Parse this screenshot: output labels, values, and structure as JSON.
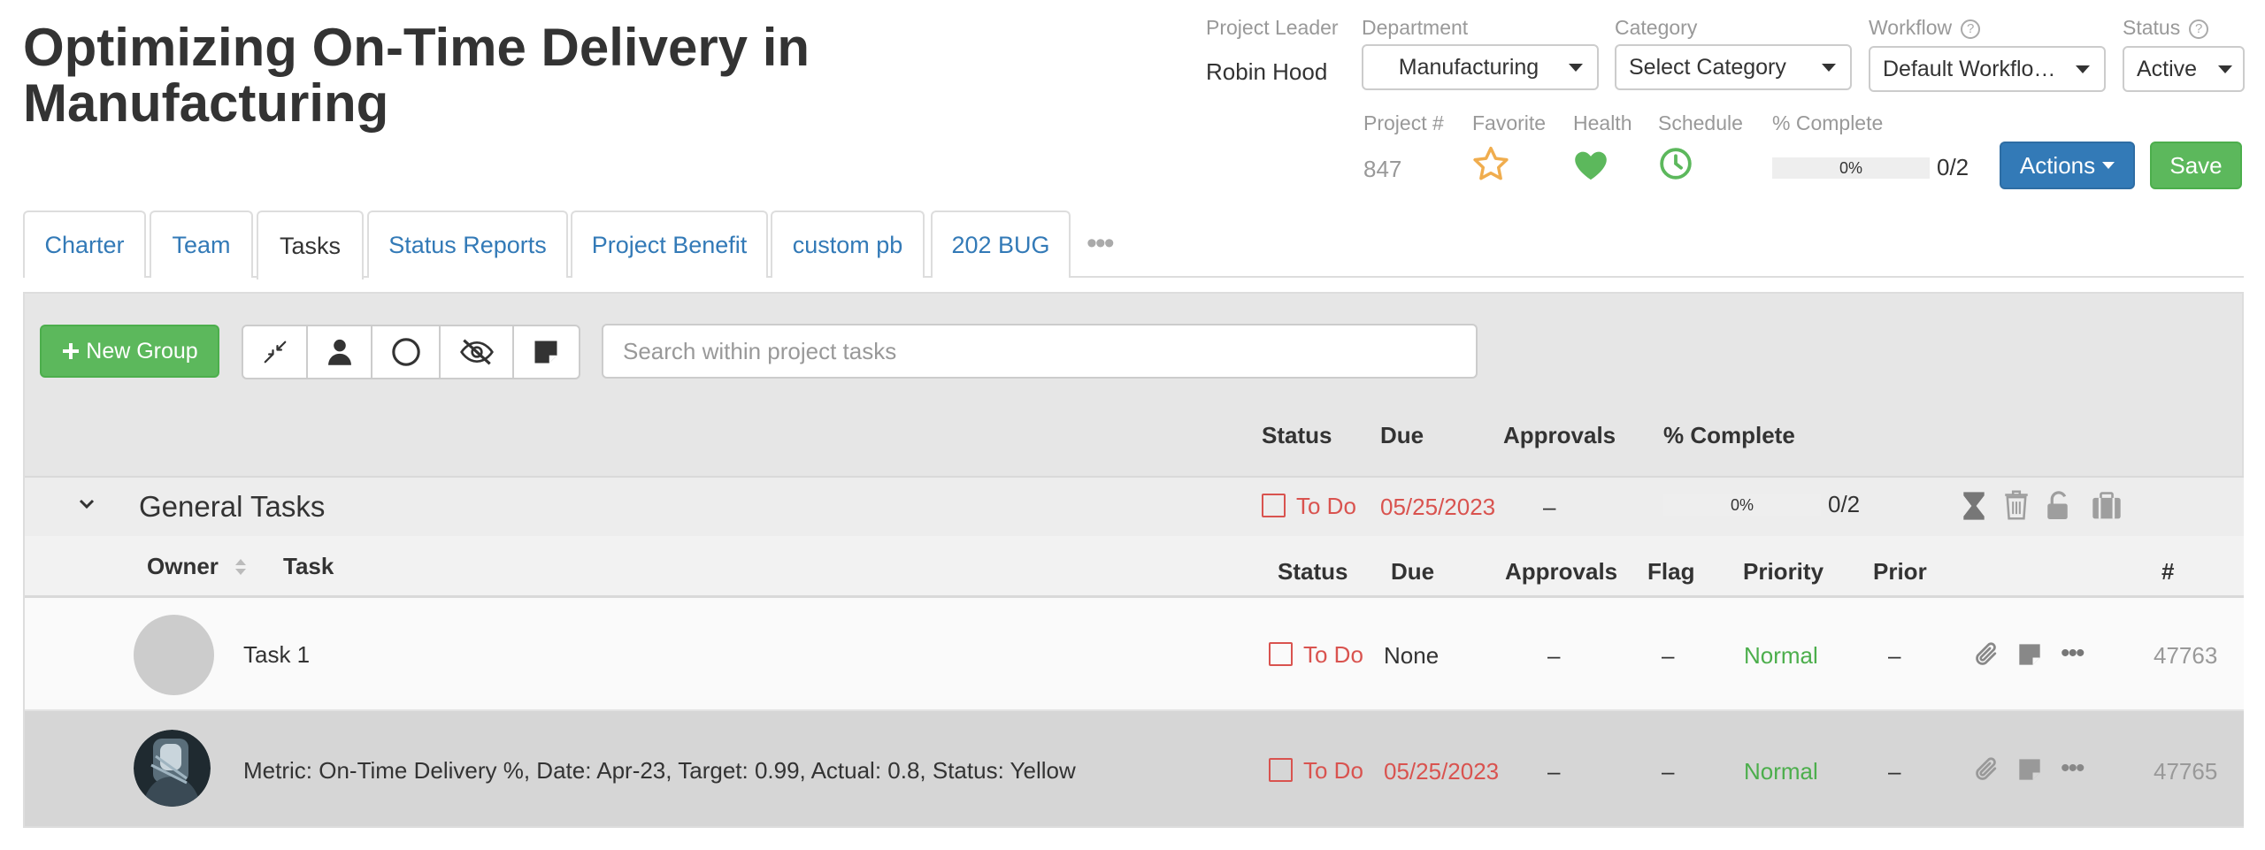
{
  "project": {
    "title": "Optimizing On-Time Delivery in Manufacturing",
    "leader_label": "Project Leader",
    "leader": "Robin Hood",
    "department_label": "Department",
    "department": "Manufacturing",
    "category_label": "Category",
    "category": "Select Category",
    "workflow_label": "Workflow",
    "workflow": "Default Workflo…",
    "status_label": "Status",
    "status": "Active",
    "number_label": "Project #",
    "number": "847",
    "favorite_label": "Favorite",
    "health_label": "Health",
    "schedule_label": "Schedule",
    "complete_label": "% Complete",
    "complete_pct": "0%",
    "complete_fraction": 0,
    "complete_count": "0/2",
    "actions_label": "Actions",
    "save_label": "Save"
  },
  "colors": {
    "link": "#337ab7",
    "success": "#5cb85c",
    "danger": "#d9534f",
    "favorite": "#f0ad4e",
    "health": "#5cb85c",
    "schedule": "#5cb85c"
  },
  "tabs": [
    {
      "label": "Charter"
    },
    {
      "label": "Team"
    },
    {
      "label": "Tasks",
      "active": true
    },
    {
      "label": "Status Reports"
    },
    {
      "label": "Project Benefit"
    },
    {
      "label": "custom pb"
    },
    {
      "label": "202 BUG"
    }
  ],
  "toolbar": {
    "new_group_label": "New Group",
    "icons": [
      "collapse-icon",
      "user-icon",
      "circle-icon",
      "eye-slash-icon",
      "note-icon"
    ],
    "search_placeholder": "Search within project tasks"
  },
  "group_header": {
    "status": "Status",
    "due": "Due",
    "approvals": "Approvals",
    "complete": "% Complete"
  },
  "group": {
    "name": "General Tasks",
    "status": "To Do",
    "due": "05/25/2023",
    "approvals": "–",
    "complete_pct": "0%",
    "complete_fraction": 0,
    "complete_count": "0/2",
    "icons": [
      "hourglass-icon",
      "trash-icon",
      "unlock-icon",
      "clipboard-icon"
    ]
  },
  "task_columns": {
    "owner": "Owner",
    "task": "Task",
    "status": "Status",
    "due": "Due",
    "approvals": "Approvals",
    "flag": "Flag",
    "priority": "Priority",
    "prior": "Prior",
    "number": "#"
  },
  "tasks": [
    {
      "name": "Task 1",
      "status": "To Do",
      "due": "None",
      "approvals": "–",
      "flag": "–",
      "priority": "Normal",
      "prior": "–",
      "number": "47763"
    },
    {
      "name": "Metric: On-Time Delivery %, Date: Apr-23, Target: 0.99, Actual: 0.8, Status: Yellow",
      "status": "To Do",
      "due": "05/25/2023",
      "approvals": "–",
      "flag": "–",
      "priority": "Normal",
      "prior": "–",
      "number": "47765"
    }
  ]
}
